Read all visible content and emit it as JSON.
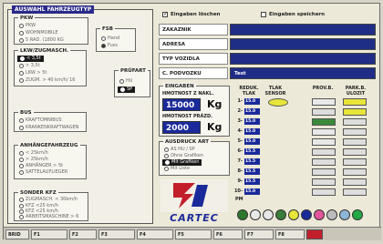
{
  "vehicle_type": {
    "title": "AUSWAHL FAHRZEUGTYP",
    "pkw": {
      "title": "PKW",
      "options": [
        "PKW",
        "WOHNMOBILE",
        "5 RAD. (1800 KG"
      ],
      "selected": -1
    },
    "fsb": {
      "title": "FSB",
      "options": [
        "Hand",
        "Fuss"
      ],
      "selected": 1
    },
    "pruefart": {
      "title": "PRÜFART",
      "options": [
        "HU",
        "SP"
      ],
      "selected": 1
    },
    "lkw": {
      "title": "LKW/ZUGMASCH.",
      "options": [
        "< 3,5t",
        "> 3,5t",
        "LKW > 5t",
        "ZUGM. > 40 km/h/ 16"
      ],
      "selected": 0
    },
    "bus": {
      "title": "BUS",
      "options": [
        "KRAFTOMNIBUS",
        "KRANKENKRAFTWAGEN"
      ],
      "selected": -1
    },
    "anh": {
      "title": "ANHÄNGEFAHRZEUG",
      "options": [
        "< 25km/h",
        "> 25km/h",
        "ANHÄNGER > 5t",
        "SATTELAUFLIEGER"
      ],
      "selected": -1
    },
    "sonder": {
      "title": "SONDER KFZ",
      "options": [
        "ZUGMASCH. < 30km/h",
        "KFZ <25 km/h",
        "KFZ <25 km/h",
        "ARBEITSMASCHINE > 6"
      ],
      "selected": -1
    }
  },
  "top_checks": {
    "delete_label": "Eingaben löschen",
    "delete_checked": true,
    "save_label": "Eingaben speichern",
    "save_checked": false
  },
  "fields": [
    {
      "label": "ZAKAZNIK",
      "value": ""
    },
    {
      "label": "ADRESA",
      "value": ""
    },
    {
      "label": "TYP VOZIDLA",
      "value": ""
    },
    {
      "label": "C. PODVOZKU",
      "value": "Test"
    }
  ],
  "eingaben": {
    "title": "EINGABEN",
    "hmotnost_label": "HMOTNOST Z NAKL.",
    "hmotnost_value": "15000",
    "hmotnost_unit": "Kg",
    "prazdno_label": "HMOTNOST PRÁZD.",
    "prazdno_value": "2000",
    "prazdno_unit": "Kg"
  },
  "ausdruck": {
    "title": "AUSDRUCK ART",
    "options": [
      "AS HU / SP",
      "Ohne Grafiken",
      "Mit Grafiken",
      "Mit Liste"
    ],
    "selected": 2
  },
  "logo_text": "CARTEC",
  "table": {
    "col_reduk": "REDUK. TLAK",
    "col_tlak": "TLAK SENSOR",
    "col_prov": "PROV.B.",
    "col_park": "PARK.B. ULOZIT",
    "rows": [
      {
        "label": "1-",
        "value": "15.0"
      },
      {
        "label": "2-",
        "value": "15.0"
      },
      {
        "label": "3-",
        "value": "15.0"
      },
      {
        "label": "4-",
        "value": "15.0"
      },
      {
        "label": "5-",
        "value": "15.0"
      },
      {
        "label": "6-",
        "value": "15.5"
      },
      {
        "label": "7-",
        "value": "15.5"
      },
      {
        "label": "8-",
        "value": "15.5"
      },
      {
        "label": "9-",
        "value": "15.5"
      },
      {
        "label": "10-",
        "value": "15.0"
      }
    ],
    "pm_label": "PM"
  },
  "palette": [
    "#2b7a2b",
    "#e9e9e9",
    "#e8e8e8",
    "#3a7c3a",
    "#e7e43a",
    "#1a2a9a",
    "#e0559a",
    "#bdbdbd",
    "#8fb6d8",
    "#22aa44"
  ],
  "taskbar": {
    "items": [
      "BRID",
      "F1",
      "F2",
      "F3",
      "F4",
      "F5",
      "F6",
      "F7",
      "F8"
    ]
  }
}
